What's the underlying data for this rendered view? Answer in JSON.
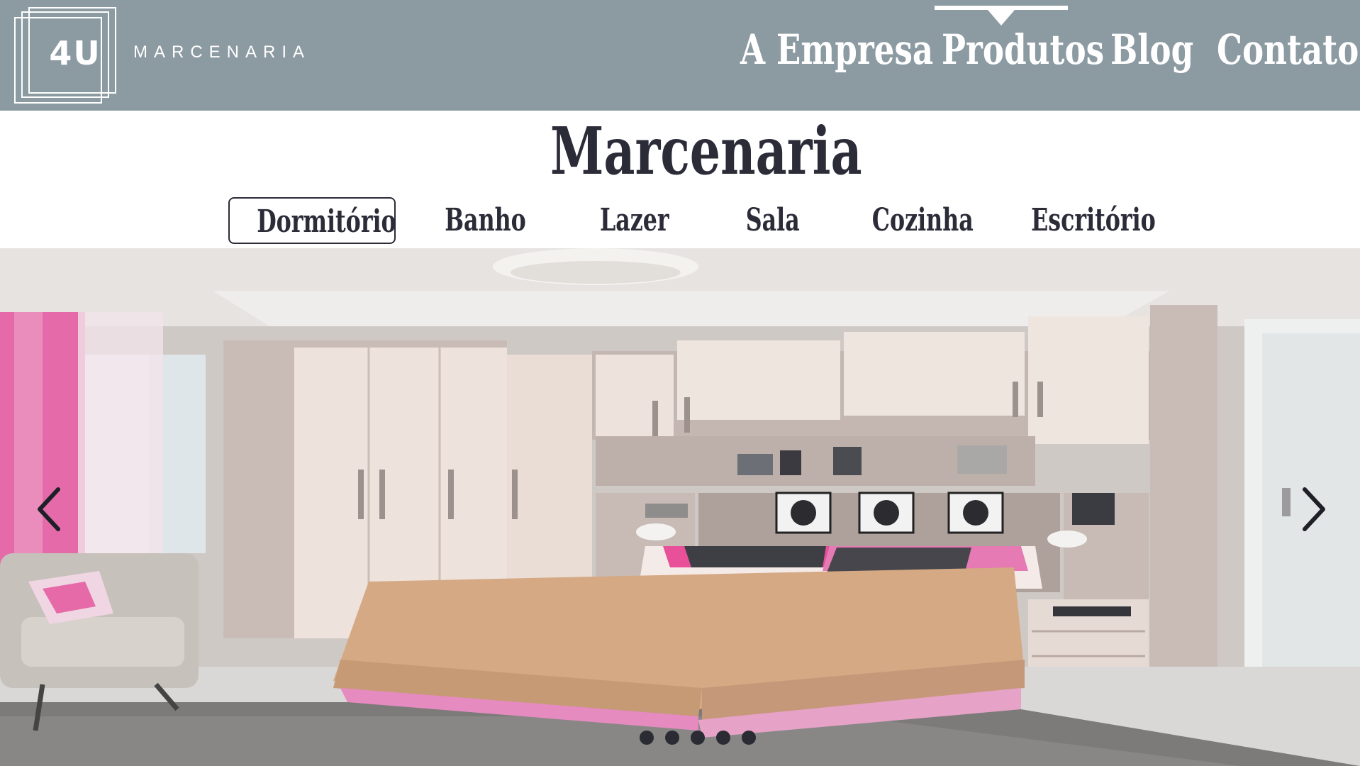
{
  "brand": {
    "logo_mark": "4U",
    "logo_word": "MARCENARIA"
  },
  "nav": {
    "items": [
      "A Empresa",
      "Produtos",
      "Blog",
      "Contato"
    ],
    "active": "Produtos"
  },
  "page": {
    "title": "Marcenaria"
  },
  "categories": {
    "items": [
      "Dormitório",
      "Banho",
      "Lazer",
      "Sala",
      "Cozinha",
      "Escritório"
    ],
    "selected": "Dormitório"
  },
  "carousel": {
    "slide_count": 5,
    "prev_icon": "chevron-left-icon",
    "next_icon": "chevron-right-icon"
  },
  "colors": {
    "header_bg": "#8c9aa2",
    "text_dark": "#2b2c38",
    "accent_pink": "#e8509a"
  }
}
